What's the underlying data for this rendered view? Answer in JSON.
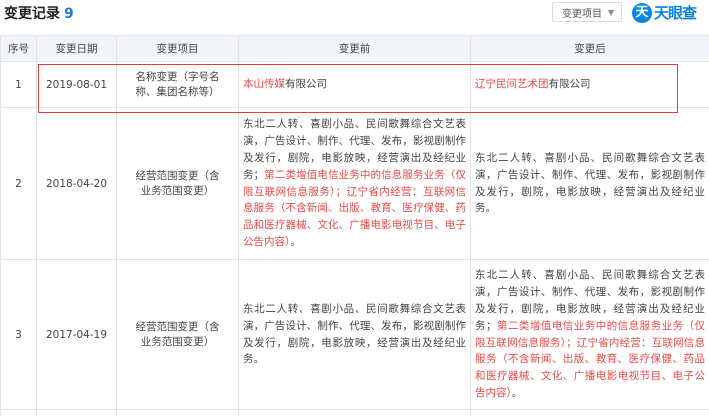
{
  "header": {
    "title": "变更记录",
    "count": "9",
    "filter_label": "变更项目",
    "filter_arrow": "▼",
    "logo_mark": "天",
    "logo_text": "天眼查"
  },
  "table": {
    "columns": [
      "序号",
      "变更日期",
      "变更项目",
      "变更前",
      "变更后"
    ],
    "rows": [
      {
        "no": "1",
        "date": "2019-08-01",
        "item": "名称变更（字号名称、集团名称等）",
        "before": [
          {
            "text": "本山传媒",
            "hl": true
          },
          {
            "text": "有限公司",
            "hl": false
          }
        ],
        "after": [
          {
            "text": "辽宁民间艺术团",
            "hl": true
          },
          {
            "text": "有限公司",
            "hl": false
          }
        ]
      },
      {
        "no": "2",
        "date": "2018-04-20",
        "item": "经营范围变更（含业务范围变更）",
        "before": [
          {
            "text": "东北二人转、喜剧小品、民间歌舞综合文艺表演，广告设计、制作、代理、发布，影视剧制作及发行，剧院，电影放映，经营演出及经纪业务；",
            "hl": false
          },
          {
            "text": "第二类增值电信业务中的信息服务业务（仅限互联网信息服务）；辽宁省内经营：互联网信息服务（不含新闻、出版、教育、医疗保健、药品和医疗器械、文化、广播电影电视节目、电子公告内容）",
            "hl": true
          },
          {
            "text": "。",
            "hl": false
          }
        ],
        "after": [
          {
            "text": "东北二人转、喜剧小品、民间歌舞综合文艺表演，广告设计、制作、代理、发布，影视剧制作及发行，剧院，电影放映，经营演出及经纪业务。",
            "hl": false
          }
        ]
      },
      {
        "no": "3",
        "date": "2017-04-19",
        "item": "经营范围变更（含业务范围变更）",
        "before": [
          {
            "text": "东北二人转、喜剧小品、民间歌舞综合文艺表演，广告设计、制作、代理、发布，影视剧制作及发行，剧院，电影放映，经营演出及经纪业务。",
            "hl": false
          }
        ],
        "after": [
          {
            "text": "东北二人转、喜剧小品、民间歌舞综合文艺表演，广告设计、制作、代理、发布，影视剧制作及发行，剧院，电影放映，经营演出及经纪业务；",
            "hl": false
          },
          {
            "text": "第二类增值电信业务中的信息服务业务（仅限互联网信息服务）；辽宁省内经营：互联网信息服务（不含新闻、出版、教育、医疗保健、药品和医疗器械、文化、广播电影电视节目、电子公告内容）",
            "hl": true
          },
          {
            "text": "。",
            "hl": false
          }
        ]
      }
    ]
  },
  "colors": {
    "accent": "#1f7ad6",
    "highlight_text": "#e84a4a",
    "highlight_border": "#e23c3c",
    "header_bg": "#f2f5fb"
  }
}
